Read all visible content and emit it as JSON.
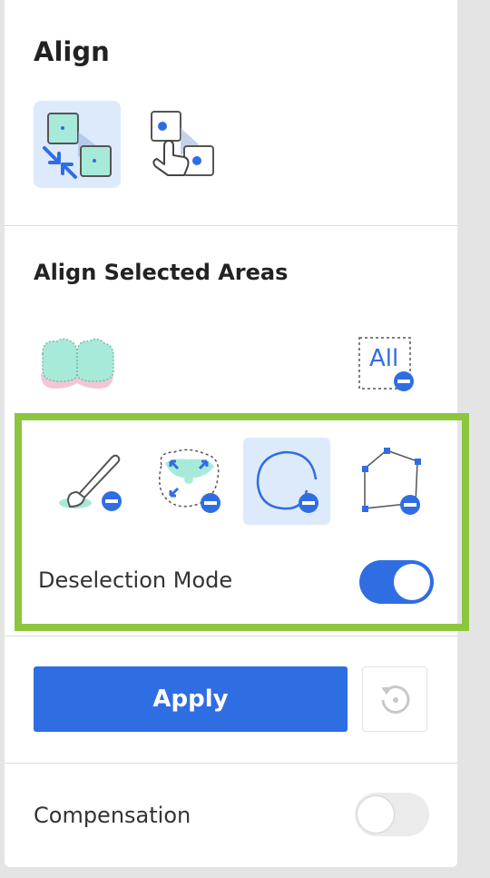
{
  "align": {
    "title": "Align",
    "modes": [
      {
        "icon": "auto-align-icon",
        "selected": true
      },
      {
        "icon": "manual-point-align-icon",
        "selected": false
      }
    ]
  },
  "areas": {
    "title": "Align Selected Areas",
    "teeth_icon": "teeth-selection-icon",
    "all_button": {
      "label": "All",
      "icon": "deselect-all-icon"
    }
  },
  "deselect_tools": {
    "tools": [
      {
        "icon": "brush-deselect-icon",
        "selected": false
      },
      {
        "icon": "smart-region-deselect-icon",
        "selected": false
      },
      {
        "icon": "lasso-deselect-icon",
        "selected": true
      },
      {
        "icon": "polygon-deselect-icon",
        "selected": false
      }
    ],
    "mode_label": "Deselection Mode",
    "mode_on": true
  },
  "actions": {
    "apply_label": "Apply",
    "reset_icon": "reset-icon"
  },
  "compensation": {
    "label": "Compensation",
    "on": false
  },
  "colors": {
    "accent": "#2f6de3",
    "highlight": "#8cc63f",
    "selected_bg": "#ddeafc",
    "teal": "#a8ead9"
  }
}
